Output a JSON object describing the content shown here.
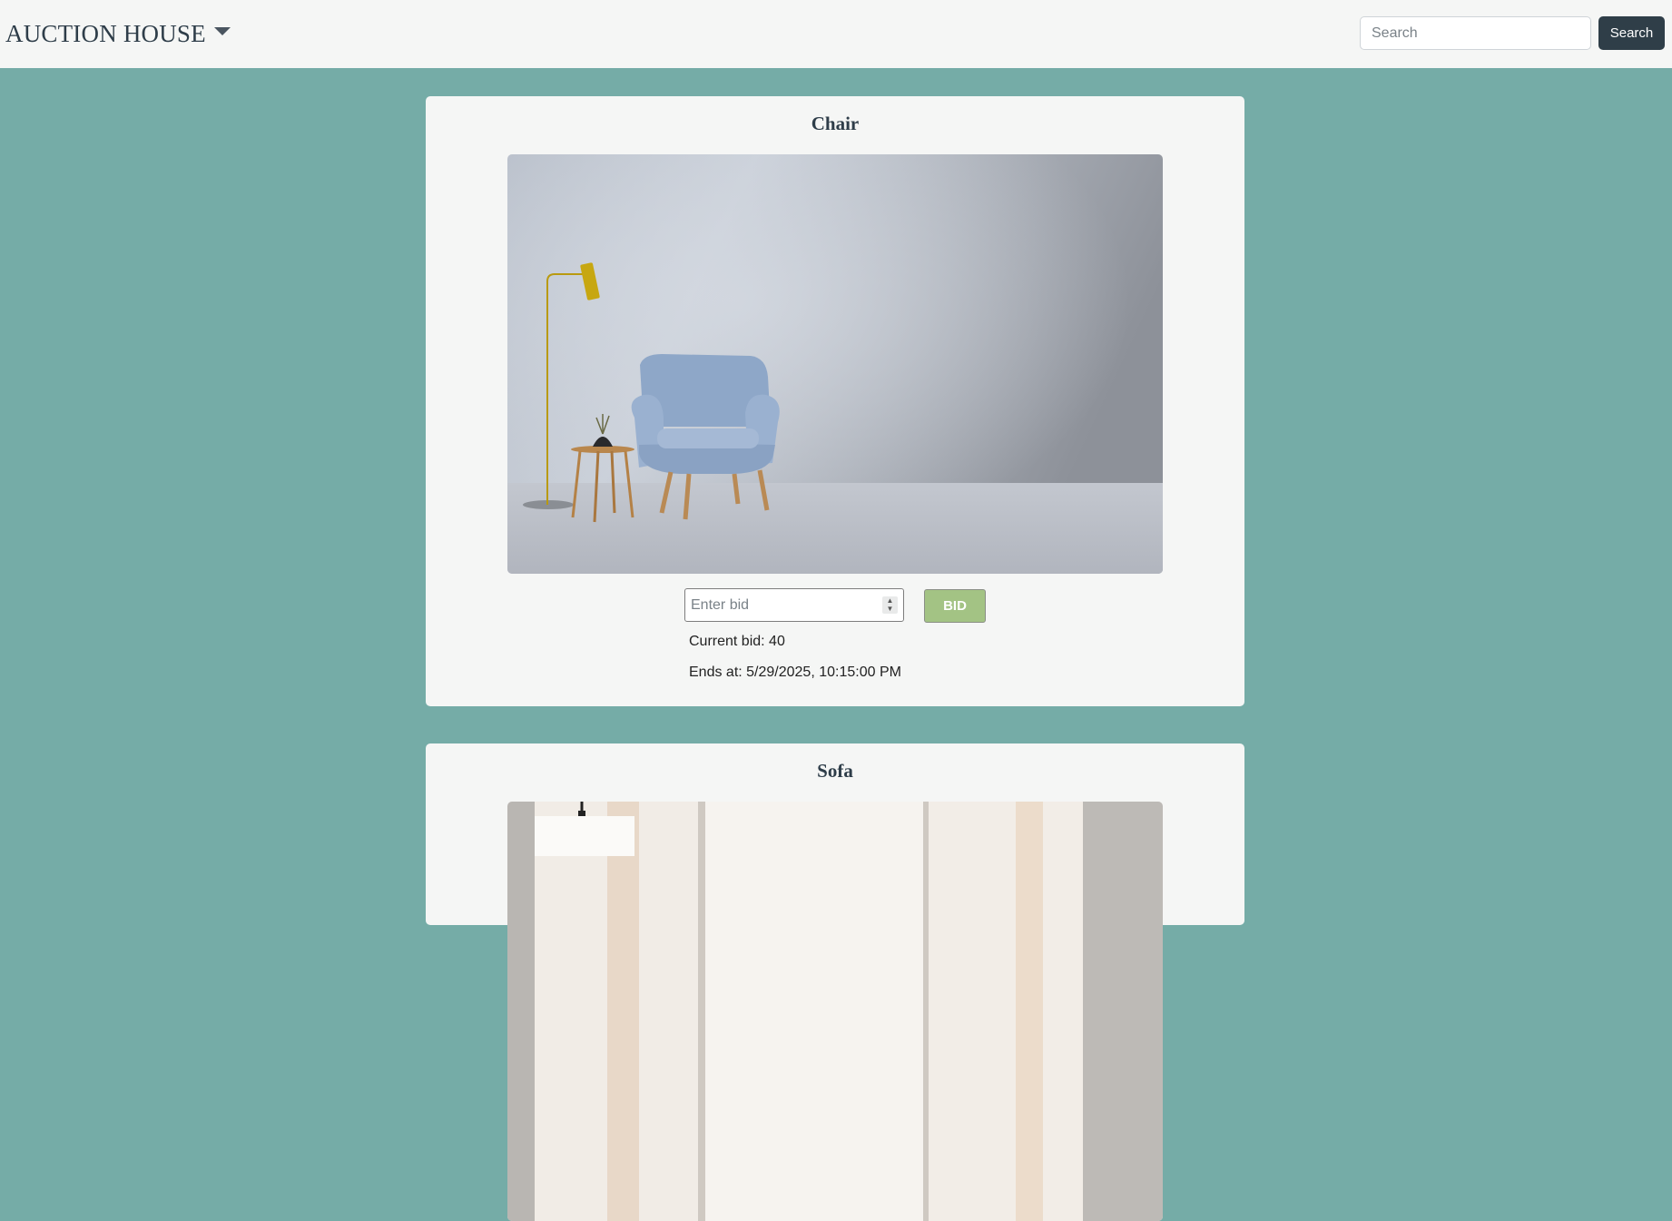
{
  "header": {
    "brand": "AUCTION HOUSE",
    "search_placeholder": "Search",
    "search_button": "Search"
  },
  "items": [
    {
      "title": "Chair",
      "bid_placeholder": "Enter bid",
      "bid_button": "BID",
      "current_bid": "Current bid: 40",
      "ends_at": "Ends at: 5/29/2025, 10:15:00 PM"
    },
    {
      "title": "Sofa"
    }
  ],
  "colors": {
    "background": "#75aca7",
    "navbar": "#f5f6f5",
    "card": "#f5f6f5",
    "search_button": "#2f3e48",
    "bid_button": "#a3c384"
  }
}
